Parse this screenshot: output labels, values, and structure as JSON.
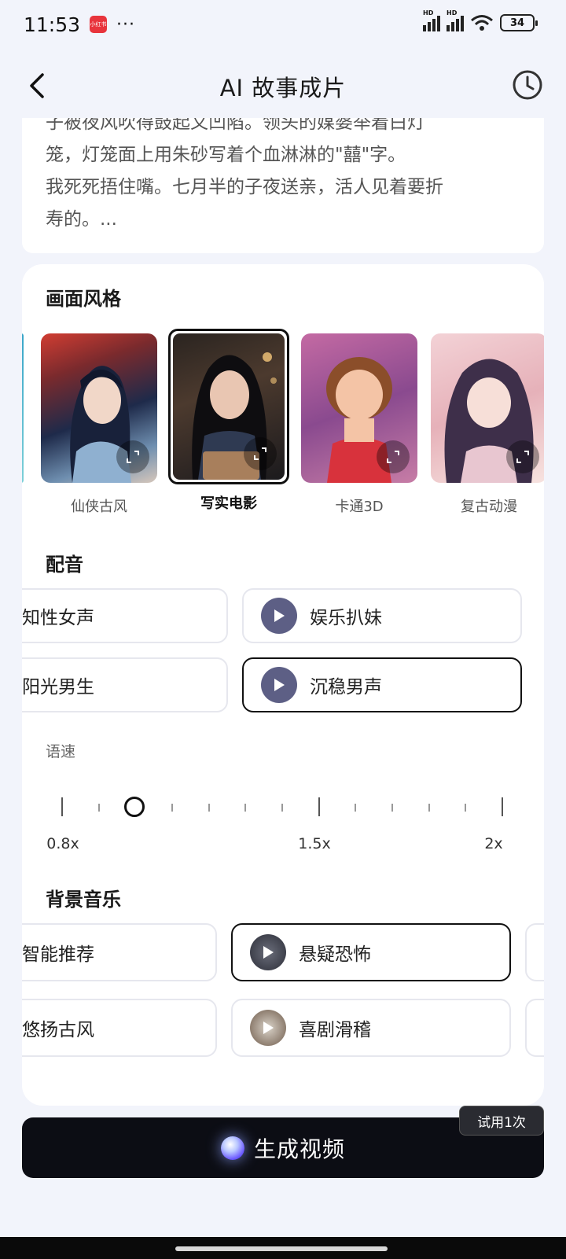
{
  "status_bar": {
    "time": "11:53",
    "app_badge": "小红书",
    "dots": "···",
    "battery": "34",
    "signal_1": "HD",
    "signal_2": "HD"
  },
  "nav": {
    "title": "AI 故事成片",
    "back_icon": "chevron-left-icon",
    "history_icon": "clock-icon"
  },
  "story": {
    "text": "子被夜风吹得鼓起又凹陷。领头的媒婆举着白灯\n笼，灯笼面上用朱砂写着个血淋淋的\"囍\"字。\n我死死捂住嘴。七月半的子夜送亲，活人见着要折\n寿的。..."
  },
  "style_section": {
    "title": "画面风格",
    "items": [
      {
        "label": "仙侠古风",
        "selected": false
      },
      {
        "label": "写实电影",
        "selected": true
      },
      {
        "label": "卡通3D",
        "selected": false
      },
      {
        "label": "复古动漫",
        "selected": false
      }
    ]
  },
  "voice_section": {
    "title": "配音",
    "options": [
      {
        "label": "知性女声",
        "selected": false
      },
      {
        "label": "娱乐扒妹",
        "selected": false
      },
      {
        "label": "阳光男生",
        "selected": false
      },
      {
        "label": "沉稳男声",
        "selected": true
      }
    ]
  },
  "speed": {
    "label": "语速",
    "marks": [
      "0.8x",
      "1.5x",
      "2x"
    ],
    "value": 1.0
  },
  "music_section": {
    "title": "背景音乐",
    "options": [
      {
        "label": "智能推荐",
        "selected": false
      },
      {
        "label": "悬疑恐怖",
        "selected": true
      },
      {
        "label": "悠扬古风",
        "selected": false
      },
      {
        "label": "喜剧滑稽",
        "selected": false
      }
    ]
  },
  "actions": {
    "generate_label": "生成视频",
    "trial_badge": "试用1次"
  },
  "colors": {
    "accent_dark": "#0c0d14",
    "play_button": "#5d5f85",
    "background": "#f2f4fb"
  }
}
